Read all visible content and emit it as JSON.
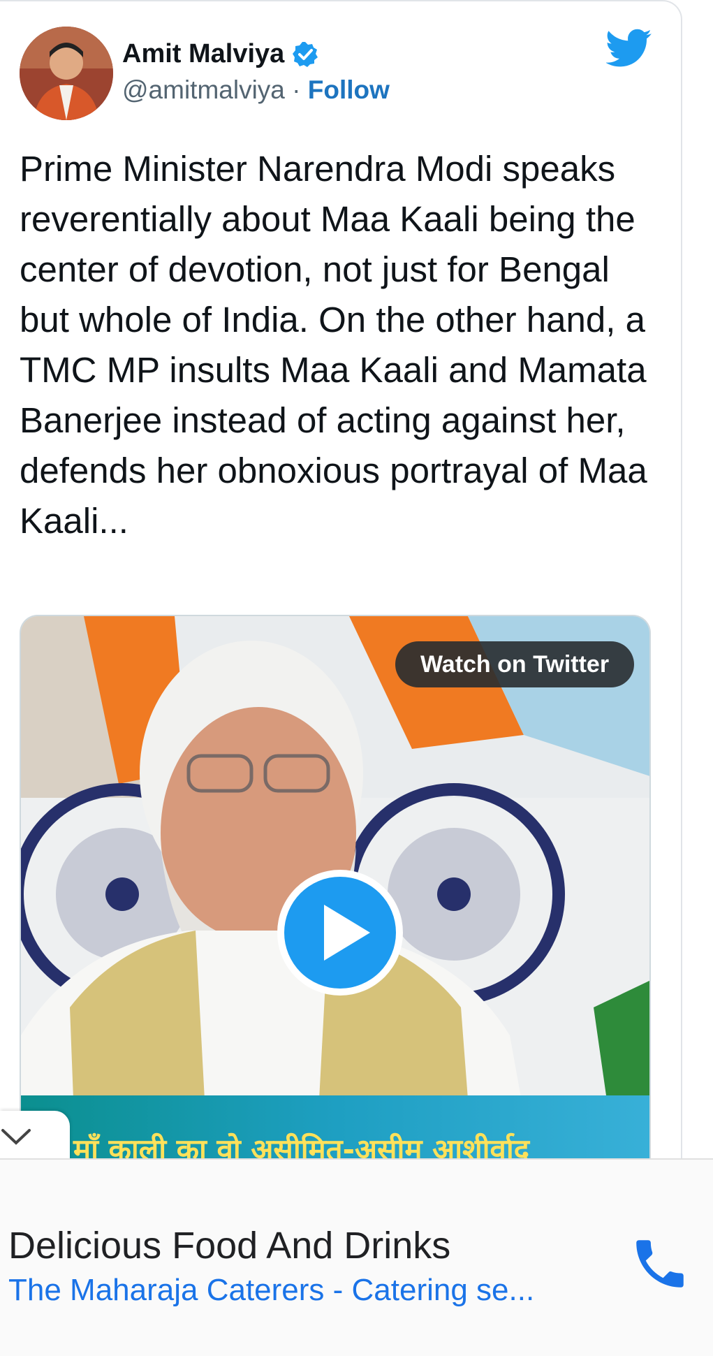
{
  "tweet": {
    "author_name": "Amit Malviya",
    "handle": "@amitmalviya",
    "separator": " · ",
    "follow_label": "Follow",
    "text": "Prime Minister Narendra Modi speaks reverentially about Maa Kaali being the center of devotion, not just for Bengal but whole of India. On the other hand, a TMC MP insults Maa Kaali and Mamata Banerjee instead of acting against her, defends her obnoxious portrayal of Maa Kaali...",
    "media": {
      "watch_label": "Watch on Twitter",
      "caption": "माँ काली का वो असीमित-असीम आशीर्वाद"
    }
  },
  "ad": {
    "title": "Delicious Food And Drinks",
    "subtitle": "The Maharaja Caterers - Catering se..."
  },
  "colors": {
    "link_blue": "#1d74bf",
    "twitter_blue": "#1d9bf0",
    "ad_blue": "#1a73e8",
    "text_dark": "#0f1419",
    "text_muted": "#536471"
  },
  "icons": [
    "twitter-bird-icon",
    "verified-badge-icon",
    "play-icon",
    "chevron-down-icon",
    "phone-icon"
  ]
}
